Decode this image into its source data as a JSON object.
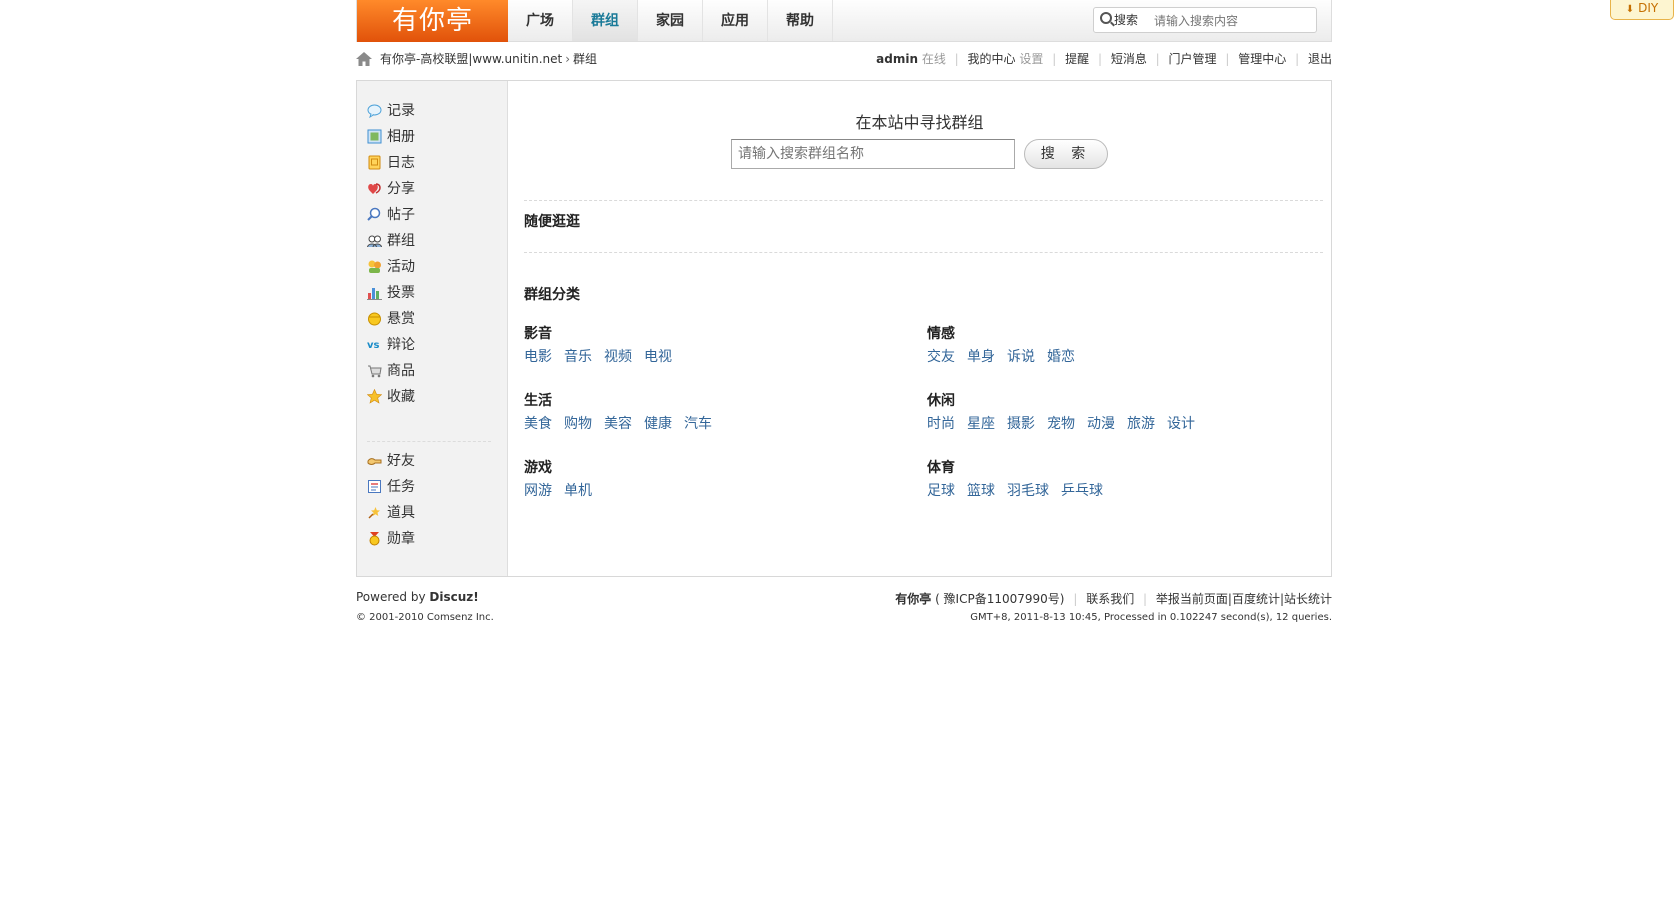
{
  "diy": {
    "label": "DIY"
  },
  "header": {
    "logo": "有你亭",
    "nav": [
      {
        "label": "广场"
      },
      {
        "label": "群组",
        "active": true
      },
      {
        "label": "家园"
      },
      {
        "label": "应用"
      },
      {
        "label": "帮助"
      }
    ],
    "search": {
      "label": "搜索",
      "placeholder": "请输入搜索内容"
    }
  },
  "breadcrumb": {
    "site": "有你亭-高校联盟|www.unitin.net",
    "separator": "›",
    "current": "群组"
  },
  "userbar": {
    "username": "admin",
    "status": "在线",
    "my_center": "我的中心",
    "settings": "设置",
    "items": [
      "提醒",
      "短消息",
      "门户管理",
      "管理中心",
      "退出"
    ]
  },
  "sidebar": {
    "items": [
      {
        "label": "记录",
        "icon": "record-icon",
        "color": "#4aa0d8"
      },
      {
        "label": "相册",
        "icon": "album-icon",
        "color": "#3f8fd0"
      },
      {
        "label": "日志",
        "icon": "blog-icon",
        "color": "#f0a020"
      },
      {
        "label": "分享",
        "icon": "share-icon",
        "color": "#e04848"
      },
      {
        "label": "帖子",
        "icon": "post-icon",
        "color": "#4a78c0"
      },
      {
        "label": "群组",
        "icon": "group-icon",
        "color": "#5a7fa8"
      },
      {
        "label": "活动",
        "icon": "activity-icon",
        "color": "#f0b030"
      },
      {
        "label": "投票",
        "icon": "poll-icon",
        "color": "#6aa0d8"
      },
      {
        "label": "悬赏",
        "icon": "reward-icon",
        "color": "#f0b000"
      },
      {
        "label": "辩论",
        "icon": "debate-icon",
        "color": "#1a8cc8"
      },
      {
        "label": "商品",
        "icon": "goods-icon",
        "color": "#999999"
      },
      {
        "label": "收藏",
        "icon": "favorite-icon",
        "color": "#f0b020"
      }
    ],
    "items2": [
      {
        "label": "好友",
        "icon": "friend-icon",
        "color": "#e0a030"
      },
      {
        "label": "任务",
        "icon": "task-icon",
        "color": "#4a78c0"
      },
      {
        "label": "道具",
        "icon": "magic-icon",
        "color": "#f0b030"
      },
      {
        "label": "勋章",
        "icon": "medal-icon",
        "color": "#e04020"
      }
    ]
  },
  "main": {
    "search_title": "在本站中寻找群组",
    "search_placeholder": "请输入搜索群组名称",
    "search_button": "搜 索",
    "random_title": "随便逛逛",
    "category_title": "群组分类",
    "categories": [
      {
        "title": "影音",
        "links": [
          "电影",
          "音乐",
          "视频",
          "电视"
        ]
      },
      {
        "title": "情感",
        "links": [
          "交友",
          "单身",
          "诉说",
          "婚恋"
        ]
      },
      {
        "title": "生活",
        "links": [
          "美食",
          "购物",
          "美容",
          "健康",
          "汽车"
        ]
      },
      {
        "title": "休闲",
        "links": [
          "时尚",
          "星座",
          "摄影",
          "宠物",
          "动漫",
          "旅游",
          "设计"
        ]
      },
      {
        "title": "游戏",
        "links": [
          "网游",
          "单机"
        ]
      },
      {
        "title": "体育",
        "links": [
          "足球",
          "篮球",
          "羽毛球",
          "乒乓球"
        ]
      }
    ]
  },
  "footer": {
    "powered_prefix": "Powered by",
    "powered_brand": "Discuz!",
    "copyright": "© 2001-2010 Comsenz Inc.",
    "site_name": "有你亭",
    "icp": "( 豫ICP备11007990号)",
    "contact": "联系我们",
    "report": "举报当前页面|百度统计|站长统计",
    "processed": "GMT+8, 2011-8-13 10:45, Processed in 0.102247 second(s), 12 queries."
  }
}
